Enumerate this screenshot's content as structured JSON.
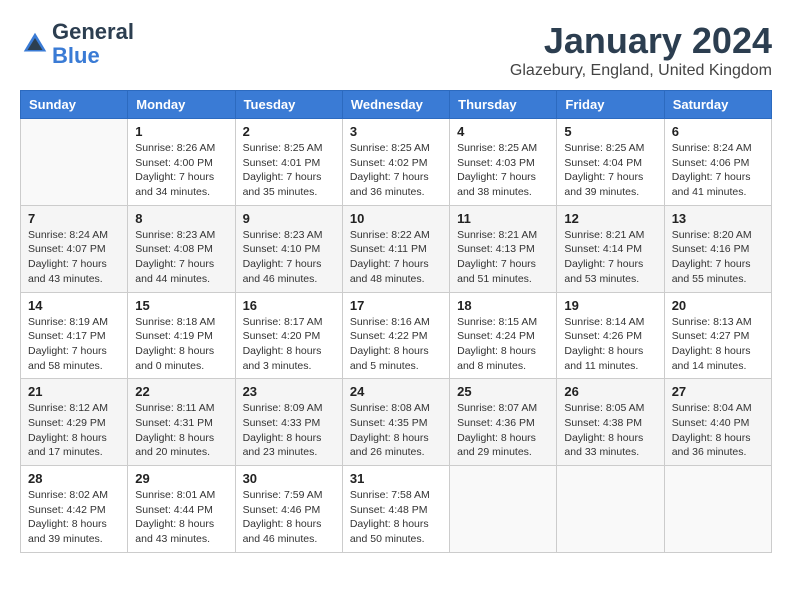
{
  "header": {
    "logo": {
      "general": "General",
      "blue": "Blue"
    },
    "title": "January 2024",
    "location": "Glazebury, England, United Kingdom"
  },
  "weekdays": [
    "Sunday",
    "Monday",
    "Tuesday",
    "Wednesday",
    "Thursday",
    "Friday",
    "Saturday"
  ],
  "weeks": [
    [
      {
        "day": "",
        "sunrise": "",
        "sunset": "",
        "daylight": ""
      },
      {
        "day": "1",
        "sunrise": "Sunrise: 8:26 AM",
        "sunset": "Sunset: 4:00 PM",
        "daylight": "Daylight: 7 hours and 34 minutes."
      },
      {
        "day": "2",
        "sunrise": "Sunrise: 8:25 AM",
        "sunset": "Sunset: 4:01 PM",
        "daylight": "Daylight: 7 hours and 35 minutes."
      },
      {
        "day": "3",
        "sunrise": "Sunrise: 8:25 AM",
        "sunset": "Sunset: 4:02 PM",
        "daylight": "Daylight: 7 hours and 36 minutes."
      },
      {
        "day": "4",
        "sunrise": "Sunrise: 8:25 AM",
        "sunset": "Sunset: 4:03 PM",
        "daylight": "Daylight: 7 hours and 38 minutes."
      },
      {
        "day": "5",
        "sunrise": "Sunrise: 8:25 AM",
        "sunset": "Sunset: 4:04 PM",
        "daylight": "Daylight: 7 hours and 39 minutes."
      },
      {
        "day": "6",
        "sunrise": "Sunrise: 8:24 AM",
        "sunset": "Sunset: 4:06 PM",
        "daylight": "Daylight: 7 hours and 41 minutes."
      }
    ],
    [
      {
        "day": "7",
        "sunrise": "Sunrise: 8:24 AM",
        "sunset": "Sunset: 4:07 PM",
        "daylight": "Daylight: 7 hours and 43 minutes."
      },
      {
        "day": "8",
        "sunrise": "Sunrise: 8:23 AM",
        "sunset": "Sunset: 4:08 PM",
        "daylight": "Daylight: 7 hours and 44 minutes."
      },
      {
        "day": "9",
        "sunrise": "Sunrise: 8:23 AM",
        "sunset": "Sunset: 4:10 PM",
        "daylight": "Daylight: 7 hours and 46 minutes."
      },
      {
        "day": "10",
        "sunrise": "Sunrise: 8:22 AM",
        "sunset": "Sunset: 4:11 PM",
        "daylight": "Daylight: 7 hours and 48 minutes."
      },
      {
        "day": "11",
        "sunrise": "Sunrise: 8:21 AM",
        "sunset": "Sunset: 4:13 PM",
        "daylight": "Daylight: 7 hours and 51 minutes."
      },
      {
        "day": "12",
        "sunrise": "Sunrise: 8:21 AM",
        "sunset": "Sunset: 4:14 PM",
        "daylight": "Daylight: 7 hours and 53 minutes."
      },
      {
        "day": "13",
        "sunrise": "Sunrise: 8:20 AM",
        "sunset": "Sunset: 4:16 PM",
        "daylight": "Daylight: 7 hours and 55 minutes."
      }
    ],
    [
      {
        "day": "14",
        "sunrise": "Sunrise: 8:19 AM",
        "sunset": "Sunset: 4:17 PM",
        "daylight": "Daylight: 7 hours and 58 minutes."
      },
      {
        "day": "15",
        "sunrise": "Sunrise: 8:18 AM",
        "sunset": "Sunset: 4:19 PM",
        "daylight": "Daylight: 8 hours and 0 minutes."
      },
      {
        "day": "16",
        "sunrise": "Sunrise: 8:17 AM",
        "sunset": "Sunset: 4:20 PM",
        "daylight": "Daylight: 8 hours and 3 minutes."
      },
      {
        "day": "17",
        "sunrise": "Sunrise: 8:16 AM",
        "sunset": "Sunset: 4:22 PM",
        "daylight": "Daylight: 8 hours and 5 minutes."
      },
      {
        "day": "18",
        "sunrise": "Sunrise: 8:15 AM",
        "sunset": "Sunset: 4:24 PM",
        "daylight": "Daylight: 8 hours and 8 minutes."
      },
      {
        "day": "19",
        "sunrise": "Sunrise: 8:14 AM",
        "sunset": "Sunset: 4:26 PM",
        "daylight": "Daylight: 8 hours and 11 minutes."
      },
      {
        "day": "20",
        "sunrise": "Sunrise: 8:13 AM",
        "sunset": "Sunset: 4:27 PM",
        "daylight": "Daylight: 8 hours and 14 minutes."
      }
    ],
    [
      {
        "day": "21",
        "sunrise": "Sunrise: 8:12 AM",
        "sunset": "Sunset: 4:29 PM",
        "daylight": "Daylight: 8 hours and 17 minutes."
      },
      {
        "day": "22",
        "sunrise": "Sunrise: 8:11 AM",
        "sunset": "Sunset: 4:31 PM",
        "daylight": "Daylight: 8 hours and 20 minutes."
      },
      {
        "day": "23",
        "sunrise": "Sunrise: 8:09 AM",
        "sunset": "Sunset: 4:33 PM",
        "daylight": "Daylight: 8 hours and 23 minutes."
      },
      {
        "day": "24",
        "sunrise": "Sunrise: 8:08 AM",
        "sunset": "Sunset: 4:35 PM",
        "daylight": "Daylight: 8 hours and 26 minutes."
      },
      {
        "day": "25",
        "sunrise": "Sunrise: 8:07 AM",
        "sunset": "Sunset: 4:36 PM",
        "daylight": "Daylight: 8 hours and 29 minutes."
      },
      {
        "day": "26",
        "sunrise": "Sunrise: 8:05 AM",
        "sunset": "Sunset: 4:38 PM",
        "daylight": "Daylight: 8 hours and 33 minutes."
      },
      {
        "day": "27",
        "sunrise": "Sunrise: 8:04 AM",
        "sunset": "Sunset: 4:40 PM",
        "daylight": "Daylight: 8 hours and 36 minutes."
      }
    ],
    [
      {
        "day": "28",
        "sunrise": "Sunrise: 8:02 AM",
        "sunset": "Sunset: 4:42 PM",
        "daylight": "Daylight: 8 hours and 39 minutes."
      },
      {
        "day": "29",
        "sunrise": "Sunrise: 8:01 AM",
        "sunset": "Sunset: 4:44 PM",
        "daylight": "Daylight: 8 hours and 43 minutes."
      },
      {
        "day": "30",
        "sunrise": "Sunrise: 7:59 AM",
        "sunset": "Sunset: 4:46 PM",
        "daylight": "Daylight: 8 hours and 46 minutes."
      },
      {
        "day": "31",
        "sunrise": "Sunrise: 7:58 AM",
        "sunset": "Sunset: 4:48 PM",
        "daylight": "Daylight: 8 hours and 50 minutes."
      },
      {
        "day": "",
        "sunrise": "",
        "sunset": "",
        "daylight": ""
      },
      {
        "day": "",
        "sunrise": "",
        "sunset": "",
        "daylight": ""
      },
      {
        "day": "",
        "sunrise": "",
        "sunset": "",
        "daylight": ""
      }
    ]
  ]
}
